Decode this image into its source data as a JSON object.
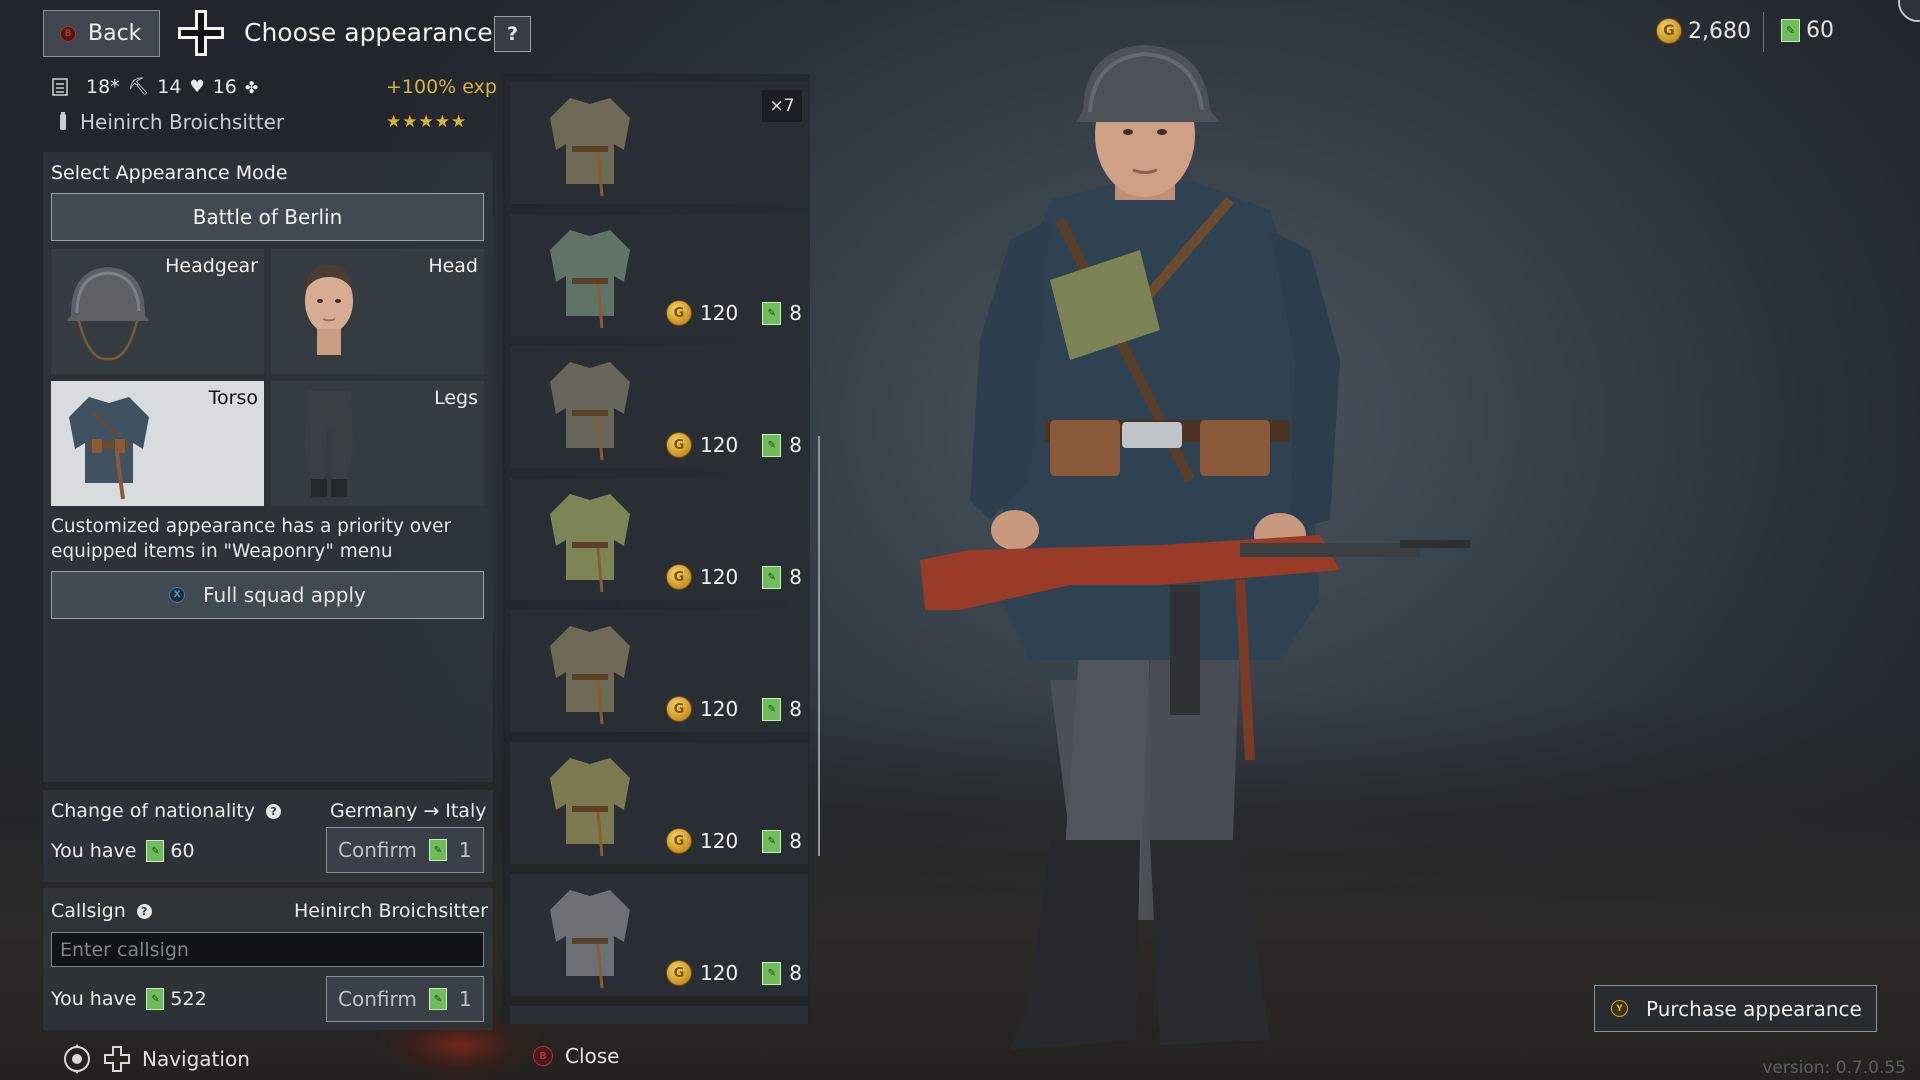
{
  "header": {
    "back_label": "Back",
    "title": "Choose appearance",
    "help_label": "?",
    "nation_icon": "iron-cross-icon",
    "gold_amount": "2,680",
    "tickets_amount": "60"
  },
  "soldier": {
    "level": "18*",
    "stat_2": "14",
    "stat_3": "16",
    "exp_bonus": "+100% exp",
    "name": "Heinirch Broichsitter",
    "stars": "★★★★★"
  },
  "appearance": {
    "mode_heading": "Select Appearance Mode",
    "mode_value": "Battle of Berlin",
    "slots": [
      {
        "label": "Headgear",
        "icon": "helmet-icon",
        "selected": false
      },
      {
        "label": "Head",
        "icon": "head-icon",
        "selected": false
      },
      {
        "label": "Torso",
        "icon": "tunic-icon",
        "selected": true
      },
      {
        "label": "Legs",
        "icon": "trousers-icon",
        "selected": false
      }
    ],
    "note": "Customized appearance has a priority over equipped items in \"Weaponry\" menu",
    "squad_apply_label": "Full squad apply"
  },
  "nationality": {
    "heading": "Change of nationality",
    "from": "Germany",
    "arrow": "→",
    "to": "Italy",
    "you_have_label": "You have",
    "you_have_value": "60",
    "confirm_label": "Confirm",
    "confirm_cost": "1"
  },
  "callsign": {
    "heading": "Callsign",
    "current": "Heinirch Broichsitter",
    "placeholder": "Enter callsign",
    "you_have_label": "You have",
    "you_have_value": "522",
    "confirm_label": "Confirm",
    "confirm_cost": "1"
  },
  "items": [
    {
      "badge": "×7",
      "gold": "",
      "tickets": "",
      "color": "#6f6a55"
    },
    {
      "badge": "",
      "gold": "120",
      "tickets": "8",
      "color": "#5f7466"
    },
    {
      "badge": "",
      "gold": "120",
      "tickets": "8",
      "color": "#66665a"
    },
    {
      "badge": "",
      "gold": "120",
      "tickets": "8",
      "color": "#7d8556"
    },
    {
      "badge": "",
      "gold": "120",
      "tickets": "8",
      "color": "#6e6a56"
    },
    {
      "badge": "",
      "gold": "120",
      "tickets": "8",
      "color": "#7c7a50"
    },
    {
      "badge": "",
      "gold": "120",
      "tickets": "8",
      "color": "#6c7075"
    }
  ],
  "footer": {
    "navigation_label": "Navigation",
    "close_label": "Close",
    "purchase_label": "Purchase appearance",
    "version": "version: 0.7.0.55"
  },
  "colors": {
    "accent_gold": "#d8b43d",
    "ticket_green": "#6fbd5a",
    "panel": "#2d343a"
  }
}
